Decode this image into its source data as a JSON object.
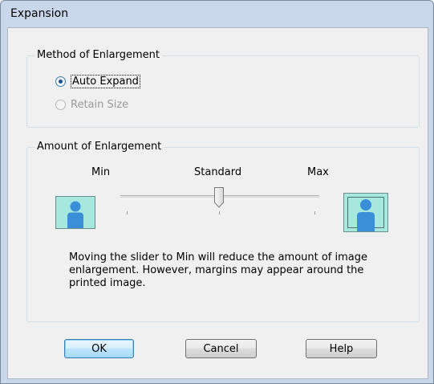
{
  "window": {
    "title": "Expansion"
  },
  "method_group": {
    "legend": "Method of Enlargement",
    "options": [
      {
        "label": "Auto Expand",
        "checked": true,
        "disabled": false
      },
      {
        "label": "Retain Size",
        "checked": false,
        "disabled": true
      }
    ]
  },
  "amount_group": {
    "legend": "Amount of Enlargement",
    "scale_labels": {
      "min": "Min",
      "standard": "Standard",
      "max": "Max"
    },
    "slider": {
      "position": "Standard"
    },
    "description": "Moving the slider to Min will reduce the amount of image enlargement. However, margins may appear around the printed image."
  },
  "buttons": {
    "ok": "OK",
    "cancel": "Cancel",
    "help": "Help"
  },
  "colors": {
    "preview_fill": "#a6e8de",
    "person_icon": "#3a8fd8",
    "title_bar": "#c8d8ea"
  }
}
